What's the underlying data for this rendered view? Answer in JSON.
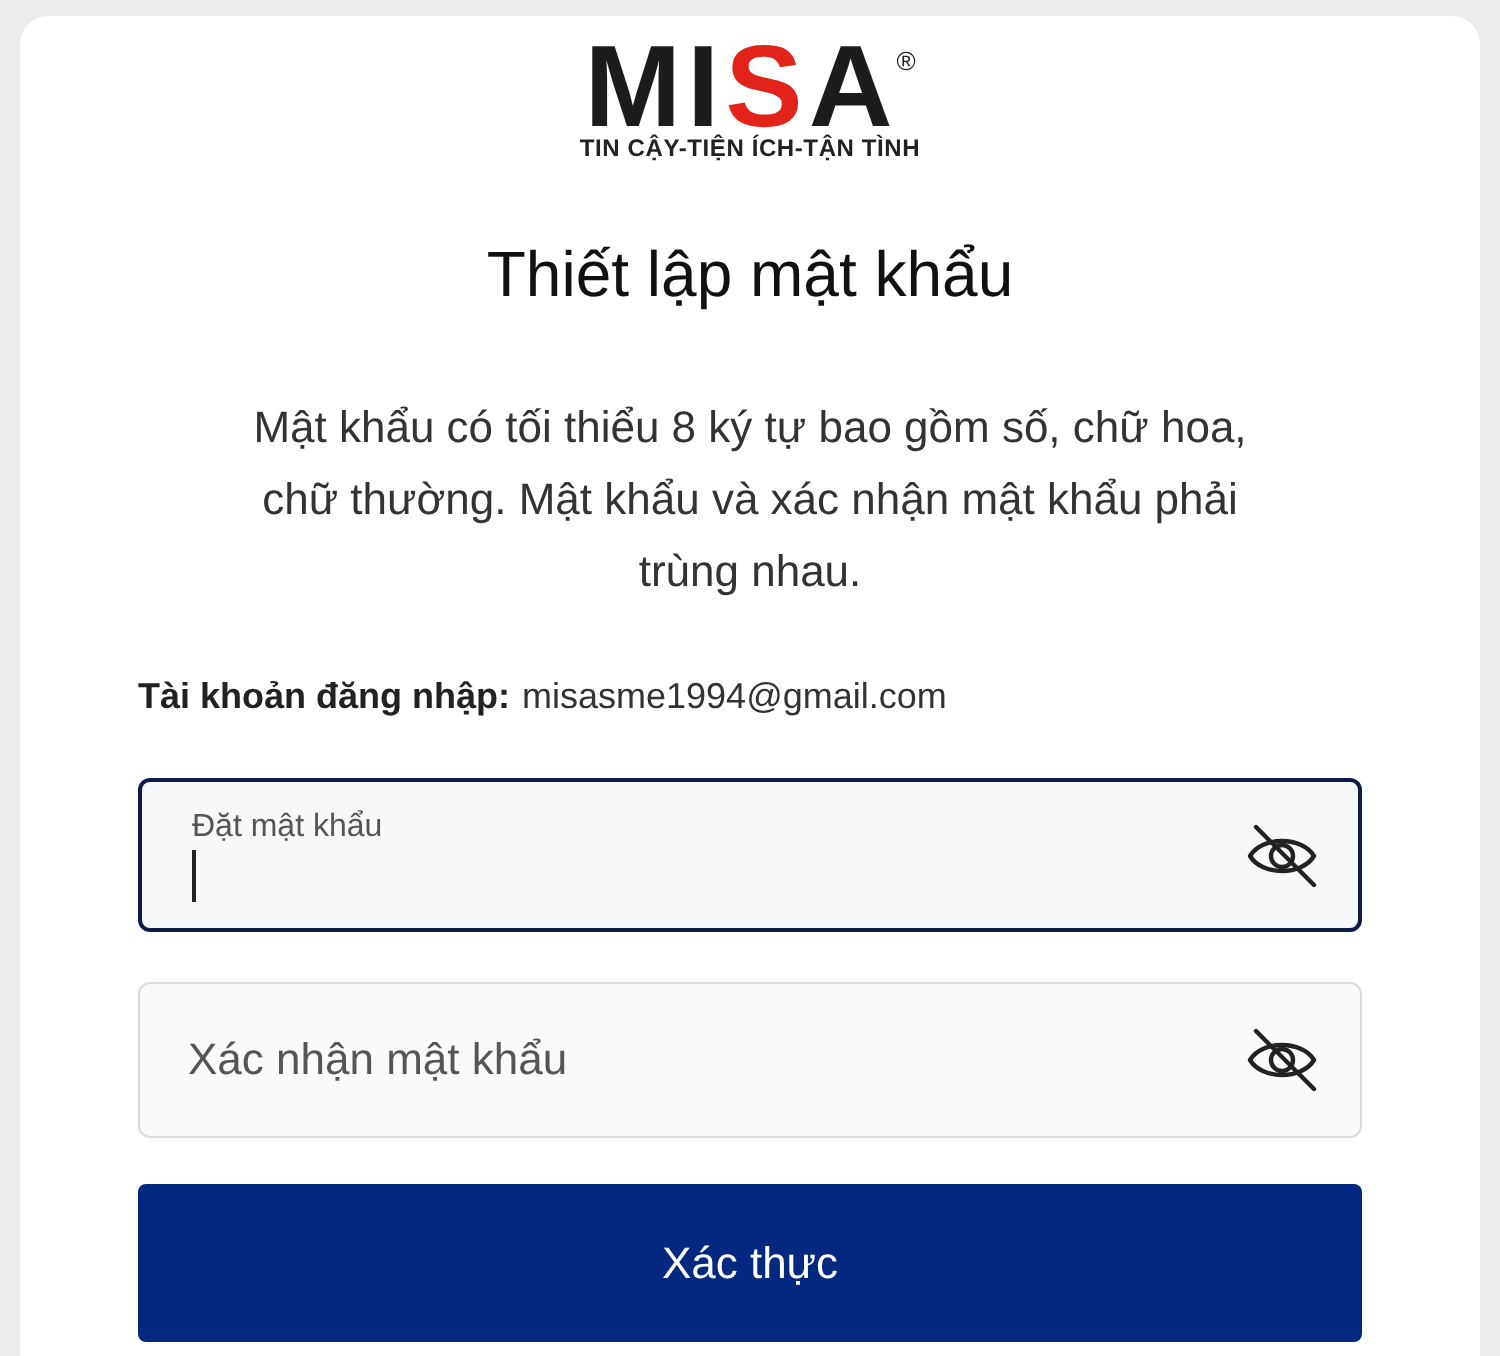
{
  "logo": {
    "wordmark": "MISA",
    "registered_mark": "®",
    "tagline": "TIN CẬY-TIỆN ÍCH-TẬN TÌNH"
  },
  "title": "Thiết lập mật khẩu",
  "description": "Mật khẩu có tối thiểu 8 ký tự bao gồm số, chữ hoa, chữ thường. Mật khẩu và xác nhận mật khẩu phải trùng nhau.",
  "account": {
    "label": "Tài khoản đăng nhập:",
    "value": "misasme1994@gmail.com"
  },
  "fields": [
    {
      "placeholder": "Đặt mật khẩu",
      "focused": true,
      "password_hidden": true
    },
    {
      "placeholder": "Xác nhận mật khẩu",
      "focused": false,
      "password_hidden": true
    }
  ],
  "submit_button": {
    "label": "Xác thực"
  }
}
